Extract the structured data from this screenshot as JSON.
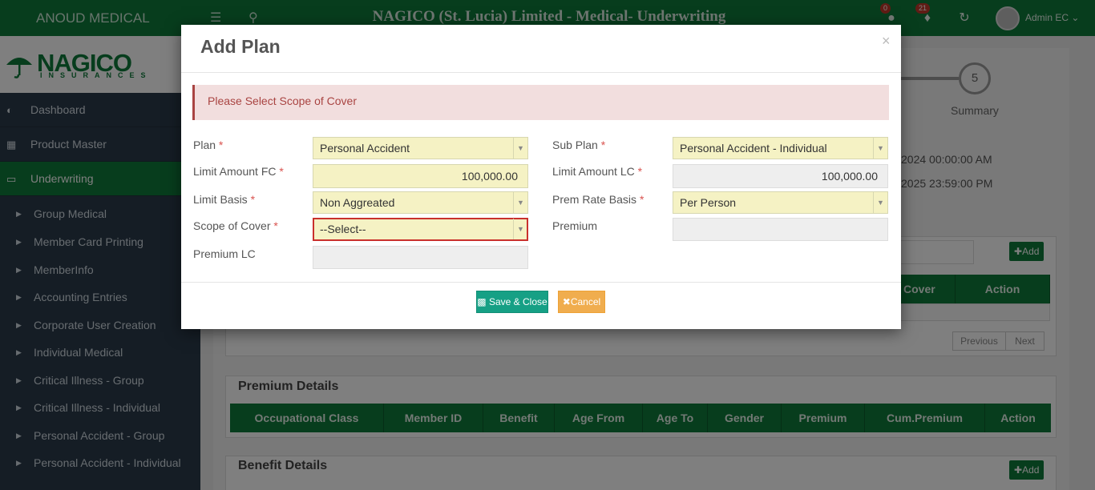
{
  "header": {
    "brand": "ANOUD MEDICAL",
    "title": "NAGICO (St. Lucia) Limited - Medical- Underwriting",
    "user_badge": "0",
    "notif_badge": "21",
    "user_name": "Admin EC"
  },
  "logo": {
    "word": "NAGICO",
    "sub": "INSURANCES"
  },
  "sidebar": {
    "main": [
      {
        "label": "Dashboard",
        "icon": "tachometer-icon"
      },
      {
        "label": "Product Master",
        "icon": "cubes-icon"
      },
      {
        "label": "Underwriting",
        "icon": "desktop-icon"
      }
    ],
    "sub": [
      "Group Medical",
      "Member Card Printing",
      "MemberInfo",
      "Accounting Entries",
      "Corporate User Creation",
      "Individual Medical",
      "Critical Illness - Group",
      "Critical Illness - Individual",
      "Personal Accident - Group",
      "Personal Accident - Individual"
    ]
  },
  "background": {
    "step_number": "5",
    "step_label": "Summary",
    "date_start": "2024 00:00:00 AM",
    "date_end": "2025 23:59:00 PM",
    "add_label": "Add",
    "cover_header": "Cover",
    "action_header": "Action",
    "previous": "Previous",
    "next": "Next",
    "premium_details_title": "Premium Details",
    "premium_columns": [
      "Occupational Class",
      "Member ID",
      "Benefit",
      "Age From",
      "Age To",
      "Gender",
      "Premium",
      "Cum.Premium",
      "Action"
    ],
    "benefit_details_title": "Benefit Details"
  },
  "modal": {
    "title": "Add Plan",
    "close": "×",
    "alert": "Please Select Scope of Cover",
    "plan_label": "Plan",
    "plan_value": "Personal Accident",
    "sub_plan_label": "Sub Plan",
    "sub_plan_value": "Personal Accident - Individual",
    "limit_fc_label": "Limit Amount FC",
    "limit_fc_value": "100,000.00",
    "limit_lc_label": "Limit Amount LC",
    "limit_lc_value": "100,000.00",
    "limit_basis_label": "Limit Basis",
    "limit_basis_value": "Non Aggreated",
    "prem_rate_label": "Prem Rate Basis",
    "prem_rate_value": "Per Person",
    "scope_label": "Scope of Cover",
    "scope_value": "--Select--",
    "premium_label": "Premium",
    "premium_lc_label": "Premium LC",
    "required_mark": "*",
    "save_label": "Save & Close",
    "cancel_label": "Cancel"
  }
}
